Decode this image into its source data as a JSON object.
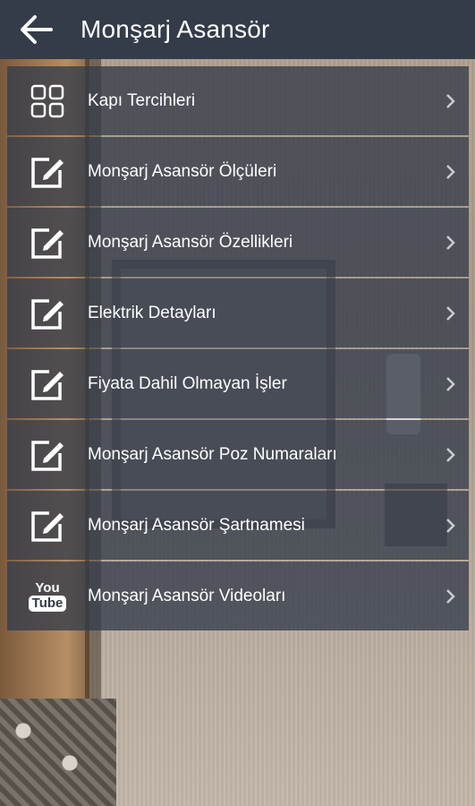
{
  "header": {
    "title": "Monşarj Asansör",
    "back_icon": "arrow-left-icon"
  },
  "menu": {
    "items": [
      {
        "label": "Kapı Tercihleri",
        "icon": "grid-icon"
      },
      {
        "label": "Monşarj Asansör Ölçüleri",
        "icon": "edit-icon"
      },
      {
        "label": "Monşarj Asansör Özellikleri",
        "icon": "edit-icon"
      },
      {
        "label": "Elektrik Detayları",
        "icon": "edit-icon"
      },
      {
        "label": "Fiyata Dahil Olmayan İşler",
        "icon": "edit-icon"
      },
      {
        "label": "Monşarj Asansör Poz Numaraları",
        "icon": "edit-icon"
      },
      {
        "label": "Monşarj Asansör Şartnamesi",
        "icon": "edit-icon"
      },
      {
        "label": "Monşarj Asansör Videoları",
        "icon": "youtube-icon"
      }
    ],
    "youtube_top": "You",
    "youtube_bottom": "Tube"
  },
  "colors": {
    "header_bg": "#343c4a",
    "item_bg": "rgba(52,60,74,0.78)",
    "text": "#ffffff",
    "chevron": "#c9ccd2"
  }
}
